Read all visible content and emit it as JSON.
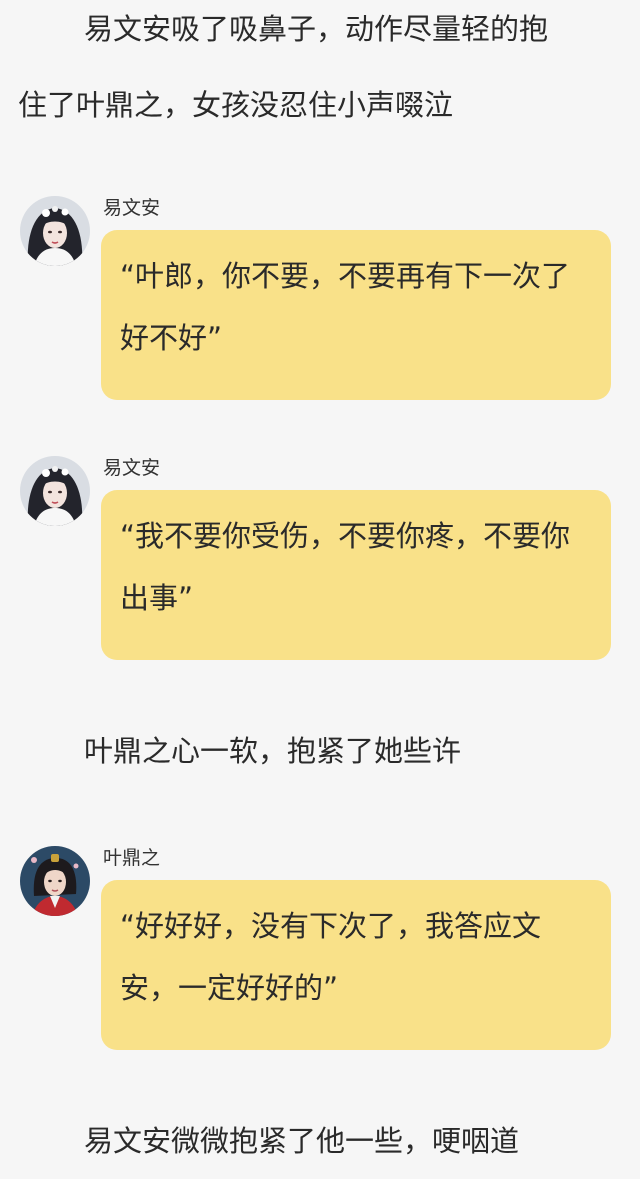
{
  "paragraphs": [
    {
      "line1": "易文安吸了吸鼻子，动作尽量轻的抱",
      "line2": "住了叶鼎之，女孩没忍住小声啜泣"
    },
    {
      "line1": "叶鼎之心一软，抱紧了她些许"
    },
    {
      "line1": "易文安微微抱紧了他一些，哽咽道"
    }
  ],
  "messages": [
    {
      "sender": "易文安",
      "avatar": "girl-avatar",
      "text": "“叶郎，你不要，不要再有下一次了好不好”"
    },
    {
      "sender": "易文安",
      "avatar": "girl-avatar",
      "text": "“我不要你受伤，不要你疼，不要你出事”"
    },
    {
      "sender": "叶鼎之",
      "avatar": "boy-avatar",
      "text": "“好好好，没有下次了，我答应文安，一定好好的”"
    }
  ],
  "colors": {
    "background": "#f6f6f6",
    "bubble": "#f9e189",
    "text": "#2a2a2a"
  }
}
